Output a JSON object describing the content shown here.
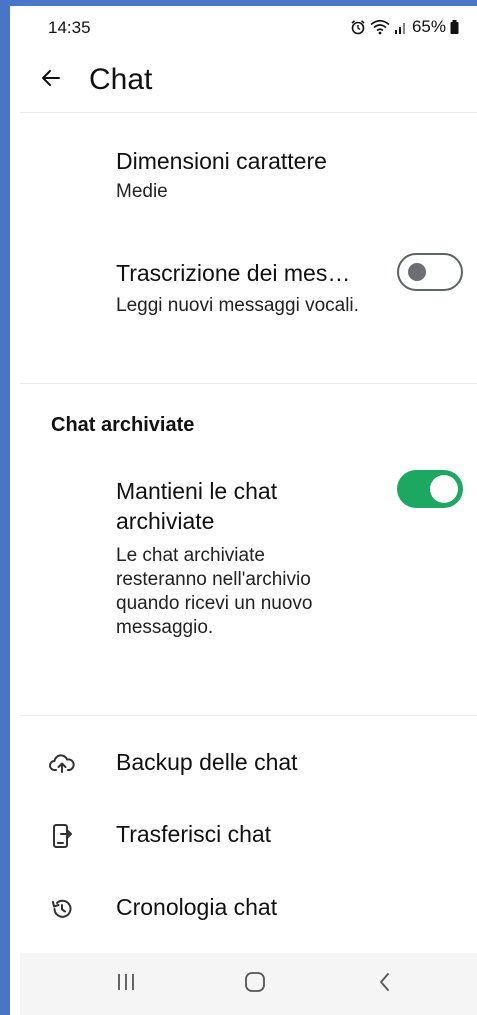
{
  "status_bar": {
    "time": "14:35",
    "battery": "65%",
    "icons": [
      "alarm-icon",
      "wifi-icon",
      "signal-icon",
      "battery-icon"
    ]
  },
  "app_bar": {
    "title": "Chat",
    "back_icon": "arrow-back-icon"
  },
  "settings": {
    "font_size": {
      "title": "Dimensioni carattere",
      "value": "Medie"
    },
    "transcription": {
      "title": "Trascrizione dei mes…",
      "subtitle": "Leggi nuovi messaggi vocali.",
      "enabled": false
    }
  },
  "archived_section": {
    "header": "Chat archiviate",
    "keep_archived": {
      "title": "Mantieni le chat archiviate",
      "subtitle": "Le chat archiviate resteranno nell'archivio quando ricevi un nuovo messaggio.",
      "enabled": true
    }
  },
  "menu": [
    {
      "label": "Backup delle chat",
      "icon": "cloud-upload-icon"
    },
    {
      "label": "Trasferisci chat",
      "icon": "phone-transfer-icon"
    },
    {
      "label": "Cronologia chat",
      "icon": "history-icon"
    }
  ],
  "nav_bar": {
    "buttons": [
      "recents-icon",
      "home-icon",
      "back-icon"
    ]
  },
  "colors": {
    "toggle_on": "#1da862",
    "toggle_off_border": "#5f6368",
    "frame_border": "#4a74c6",
    "nav_bg": "#f5f5f5"
  }
}
